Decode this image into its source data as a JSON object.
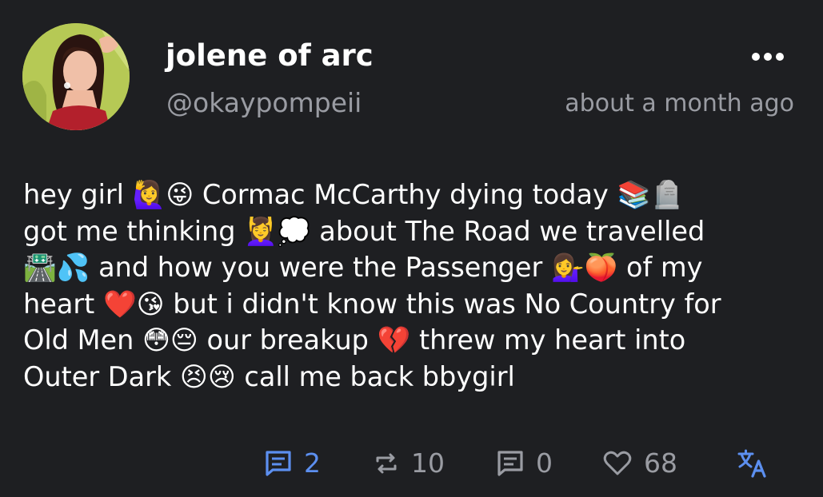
{
  "author": {
    "display_name": "jolene of arc",
    "handle": "@okaypompeii",
    "avatar_icon": "profile-photo"
  },
  "post": {
    "timestamp": "about a month ago",
    "content_lines": [
      [
        "hey girl ",
        "🙋‍♀️😜",
        " Cormac McCarthy dying today ",
        "📚🪦"
      ],
      [
        "got me thinking ",
        "💆‍♀️💭",
        " about The Road we travelled"
      ],
      [
        "🛣️💦",
        " and how you were the Passenger ",
        "💁‍♀️🍑",
        " of my"
      ],
      [
        "heart ",
        "❤️😘",
        " but i didn't know this was No Country for"
      ],
      [
        "Old Men ",
        "😳😔",
        " our breakup ",
        "💔",
        " threw my heart into"
      ],
      [
        "Outer Dark ",
        "😣😢",
        " call me back bbygirl"
      ]
    ]
  },
  "actions": {
    "replies": {
      "icon": "reply-icon",
      "count": "2"
    },
    "boosts": {
      "icon": "boost-icon",
      "count": "10"
    },
    "quotes": {
      "icon": "quote-icon",
      "count": "0"
    },
    "likes": {
      "icon": "heart-icon",
      "count": "68"
    },
    "translate": {
      "icon": "translate-icon"
    }
  },
  "colors": {
    "background": "#1e1f22",
    "text": "#ffffff",
    "muted": "#9a9ca3",
    "accent": "#5c8ff0"
  }
}
